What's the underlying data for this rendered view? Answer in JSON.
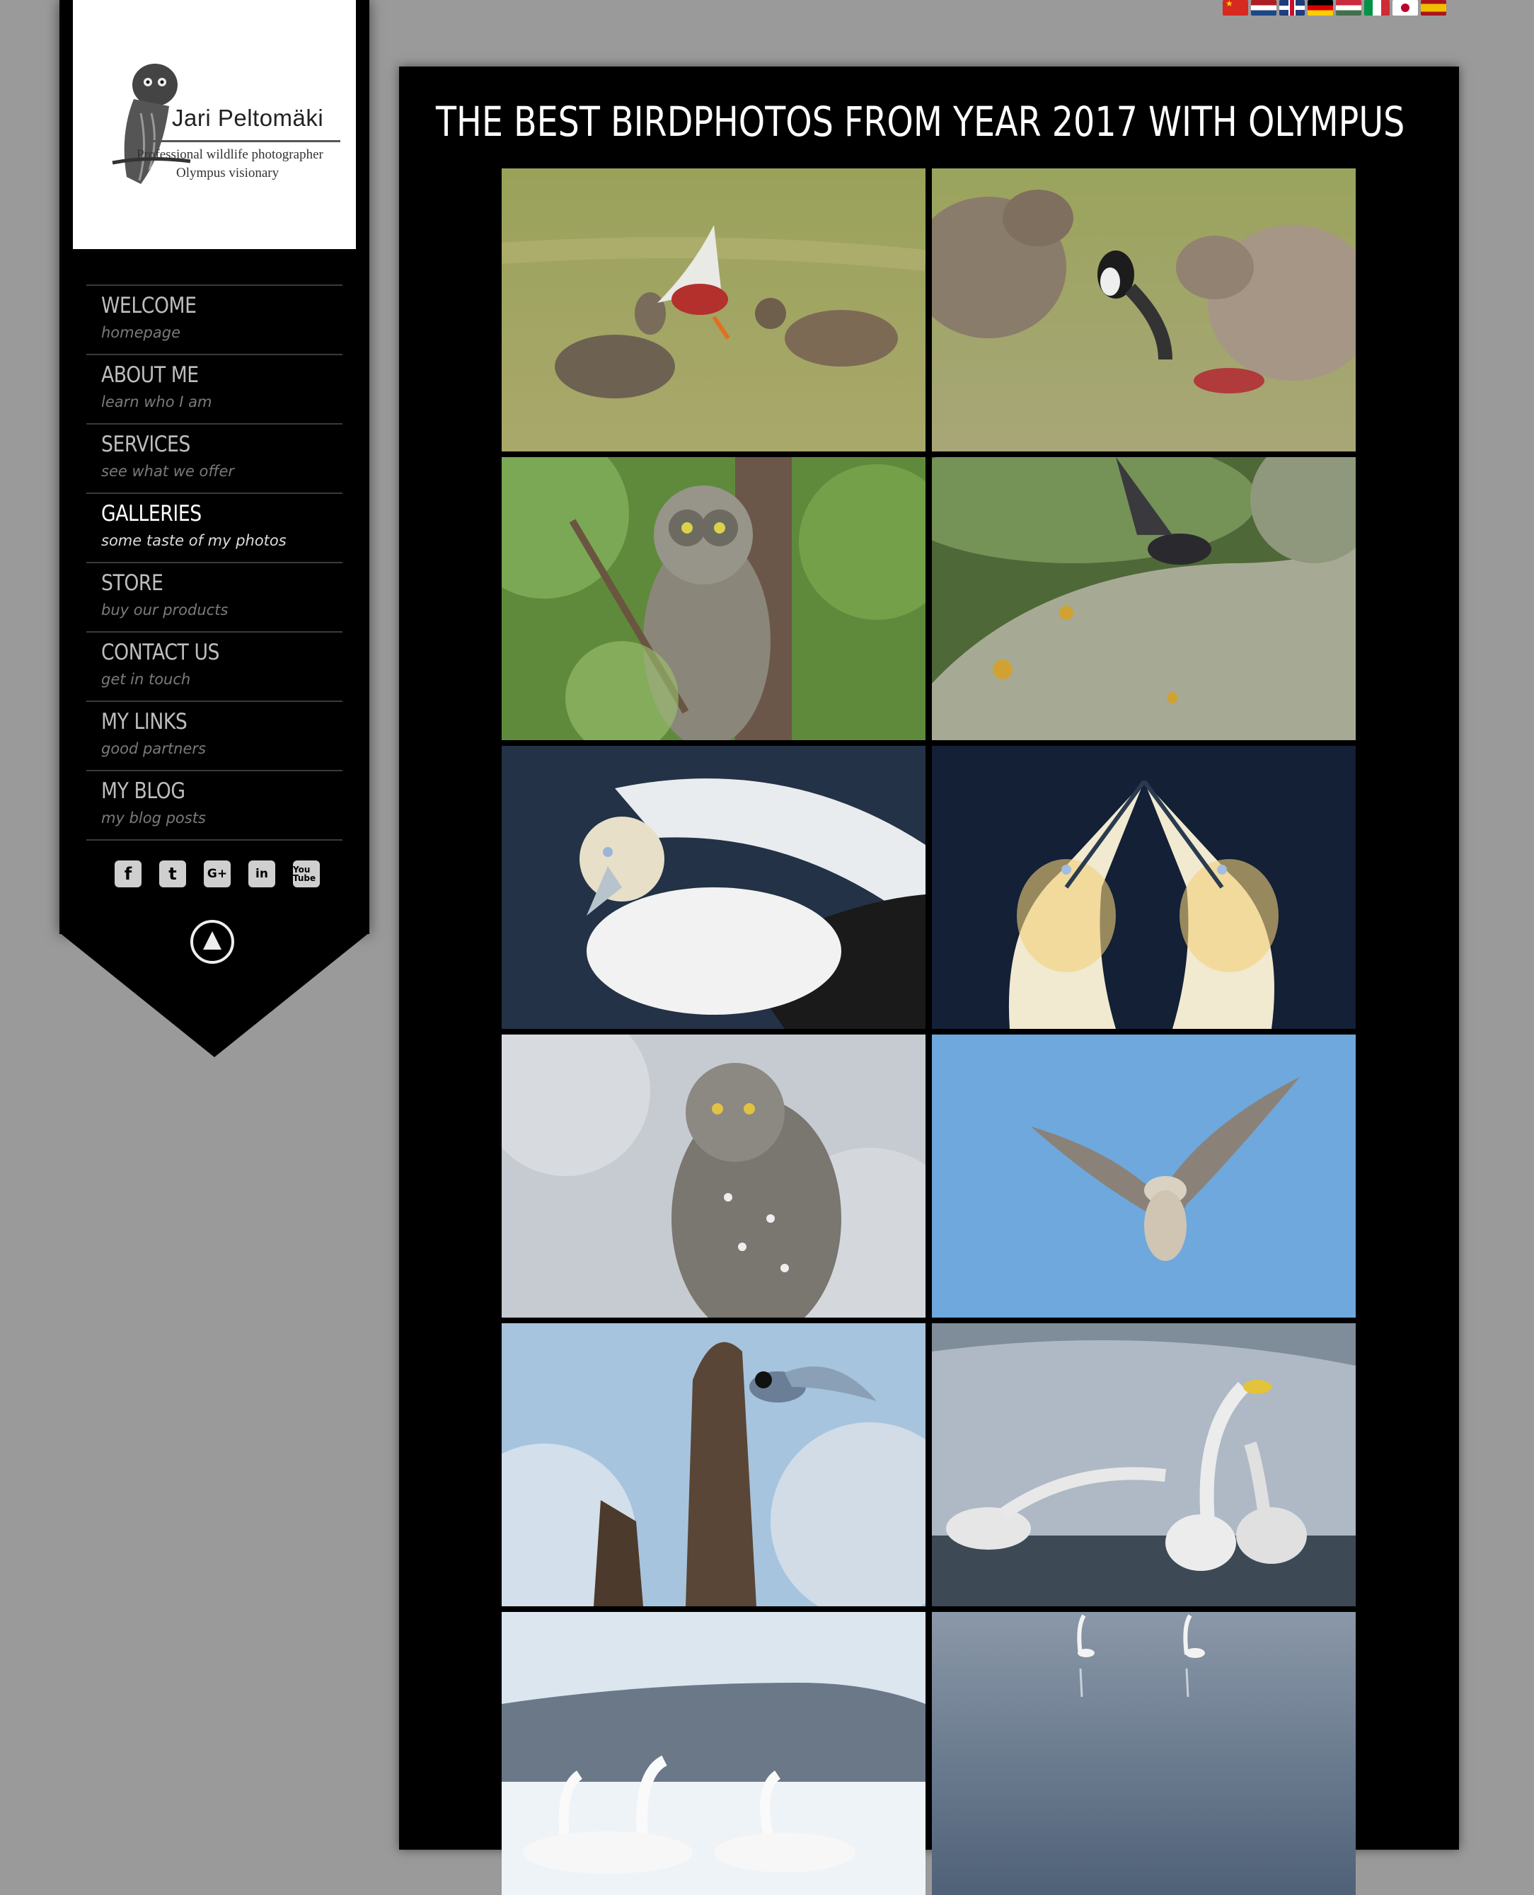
{
  "logo": {
    "name": "Jari Peltomäki",
    "tagline_1": "Professional wildlife photographer",
    "tagline_2": "Olympus visionary"
  },
  "nav": [
    {
      "title": "WELCOME",
      "subtitle": "homepage",
      "active": false
    },
    {
      "title": "ABOUT ME",
      "subtitle": "learn who I am",
      "active": false
    },
    {
      "title": "SERVICES",
      "subtitle": "see what we offer",
      "active": false
    },
    {
      "title": "GALLERIES",
      "subtitle": "some taste of my photos",
      "active": true
    },
    {
      "title": "STORE",
      "subtitle": "buy our products",
      "active": false
    },
    {
      "title": "CONTACT US",
      "subtitle": "get in touch",
      "active": false
    },
    {
      "title": "MY LINKS",
      "subtitle": "good partners",
      "active": false
    },
    {
      "title": "MY BLOG",
      "subtitle": "my blog posts",
      "active": false
    }
  ],
  "social": [
    {
      "icon": "facebook-icon",
      "glyph": "f"
    },
    {
      "icon": "twitter-icon",
      "glyph": "t"
    },
    {
      "icon": "google-plus-icon",
      "glyph": "G+"
    },
    {
      "icon": "linkedin-icon",
      "glyph": "in"
    },
    {
      "icon": "youtube-icon",
      "glyph": "You Tube"
    }
  ],
  "back_to_top_icon": "arrow-up-circle-icon",
  "flags": [
    "china",
    "netherlands",
    "united-kingdom",
    "germany",
    "hungary",
    "italy",
    "japan",
    "spain"
  ],
  "page": {
    "title": "THE BEST BIRDPHOTOS FROM YEAR 2017 WITH OLYMPUS"
  },
  "colors": {
    "page_background": "#9a9a9a",
    "panel_background": "#000000",
    "nav_text": "#bdbdbd",
    "nav_active_text": "#ffffff"
  }
}
